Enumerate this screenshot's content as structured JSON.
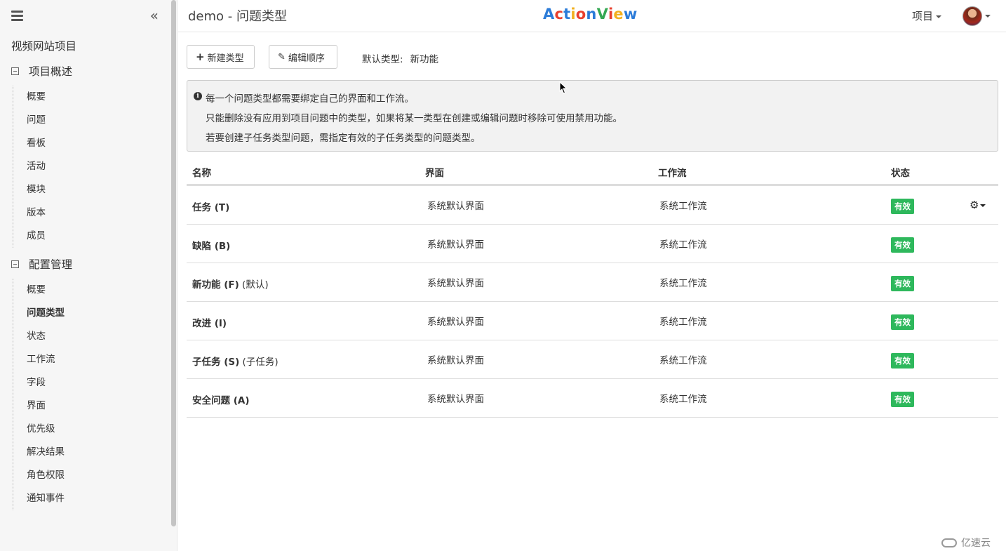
{
  "sidebar": {
    "project_name": "视频网站项目",
    "collapse_glyph": "«",
    "groups": [
      {
        "title": "项目概述",
        "items": [
          "概要",
          "问题",
          "看板",
          "活动",
          "模块",
          "版本",
          "成员"
        ]
      },
      {
        "title": "配置管理",
        "items": [
          "概要",
          "问题类型",
          "状态",
          "工作流",
          "字段",
          "界面",
          "优先级",
          "解决结果",
          "角色权限",
          "通知事件"
        ]
      }
    ],
    "active_item": "问题类型"
  },
  "header": {
    "title": "demo - 问题类型",
    "logo_letters": [
      {
        "ch": "A",
        "color": "#2b7bd8"
      },
      {
        "ch": "c",
        "color": "#e8402e"
      },
      {
        "ch": "t",
        "color": "#2b7bd8"
      },
      {
        "ch": "i",
        "color": "#f2b01e"
      },
      {
        "ch": "o",
        "color": "#e8402e"
      },
      {
        "ch": "n",
        "color": "#2b7bd8"
      },
      {
        "ch": "V",
        "color": "#34a853"
      },
      {
        "ch": "i",
        "color": "#e8402e"
      },
      {
        "ch": "e",
        "color": "#f2b01e"
      },
      {
        "ch": "w",
        "color": "#2b7bd8"
      }
    ],
    "project_menu": "项目"
  },
  "toolbar": {
    "new_type_icon": "+",
    "new_type": "新建类型",
    "edit_order_icon": "✎",
    "edit_order": "编辑顺序",
    "default_type_label": "默认类型:",
    "default_type_value": "新功能"
  },
  "info": {
    "icon": "i",
    "lines": [
      "每一个问题类型都需要绑定自己的界面和工作流。",
      "只能删除没有应用到项目问题中的类型，如果将某一类型在创建或编辑问题时移除可使用禁用功能。",
      "若要创建子任务类型问题，需指定有效的子任务类型的问题类型。"
    ]
  },
  "table": {
    "headers": [
      "名称",
      "界面",
      "工作流",
      "状态"
    ],
    "rows": [
      {
        "name": "任务 (T)",
        "suffix": "",
        "screen": "系统默认界面",
        "workflow": "系统工作流",
        "status": "有效"
      },
      {
        "name": "缺陷 (B)",
        "suffix": "",
        "screen": "系统默认界面",
        "workflow": "系统工作流",
        "status": "有效"
      },
      {
        "name": "新功能 (F)",
        "suffix": " (默认)",
        "screen": "系统默认界面",
        "workflow": "系统工作流",
        "status": "有效"
      },
      {
        "name": "改进 (I)",
        "suffix": "",
        "screen": "系统默认界面",
        "workflow": "系统工作流",
        "status": "有效"
      },
      {
        "name": "子任务 (S)",
        "suffix": " (子任务)",
        "screen": "系统默认界面",
        "workflow": "系统工作流",
        "status": "有效"
      },
      {
        "name": "安全问题 (A)",
        "suffix": "",
        "screen": "系统默认界面",
        "workflow": "系统工作流",
        "status": "有效"
      }
    ],
    "row_action_icon": "gear-icon"
  },
  "watermark": "亿速云",
  "colors": {
    "status_badge": "#2eb85c"
  }
}
